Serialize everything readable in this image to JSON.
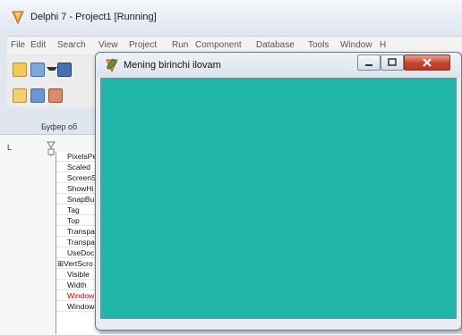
{
  "ide": {
    "title": "Delphi 7 - Project1 [Running]",
    "menu": [
      "File",
      "Edit",
      "Search",
      "View",
      "Project",
      "Run",
      "Component",
      "Database",
      "Tools",
      "Window",
      "H"
    ],
    "clipboard_label": "Буфер об",
    "structure_label": "L"
  },
  "properties": [
    {
      "name": "PixelsPe",
      "style": "normal"
    },
    {
      "name": "Scaled",
      "style": "normal"
    },
    {
      "name": "ScreenS",
      "style": "normal"
    },
    {
      "name": "ShowHi",
      "style": "normal"
    },
    {
      "name": "SnapBu",
      "style": "normal"
    },
    {
      "name": "Tag",
      "style": "normal"
    },
    {
      "name": "Top",
      "style": "normal"
    },
    {
      "name": "Transpa",
      "style": "normal"
    },
    {
      "name": "Transpa",
      "style": "normal"
    },
    {
      "name": "UseDoc",
      "style": "normal"
    },
    {
      "name": "⊞VertScro",
      "style": "expandable"
    },
    {
      "name": "Visible",
      "style": "normal"
    },
    {
      "name": "Width",
      "style": "normal"
    },
    {
      "name": "Window",
      "style": "highlight"
    },
    {
      "name": "WindowState",
      "style": "normal"
    }
  ],
  "form": {
    "title": "Mening birinchi ilovam",
    "client_color": "#1fb5a8",
    "buttons": [
      "minimize",
      "maximize",
      "close"
    ]
  },
  "colors": {
    "close_button": "#c5452c",
    "property_highlight": "#c00000"
  }
}
